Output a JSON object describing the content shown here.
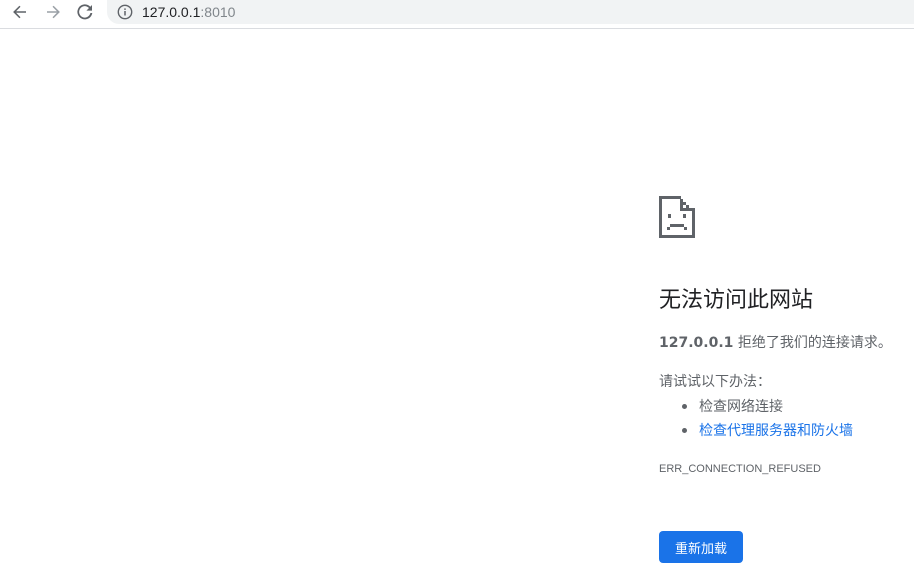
{
  "toolbar": {
    "back_icon": "arrow-left-icon",
    "forward_icon": "arrow-right-icon",
    "reload_icon": "reload-icon",
    "info_icon": "info-icon",
    "url_host": "127.0.0.1",
    "url_port": ":8010"
  },
  "error_page": {
    "icon": "sad-page-icon",
    "headline": "无法访问此网站",
    "host": "127.0.0.1",
    "message_rest": " 拒绝了我们的连接请求。",
    "try_label": "请试试以下办法：",
    "suggestions": [
      {
        "label": "检查网络连接",
        "is_link": false
      },
      {
        "label": "检查代理服务器和防火墙",
        "is_link": true
      }
    ],
    "error_code": "ERR_CONNECTION_REFUSED",
    "reload_label": "重新加载"
  },
  "colors": {
    "accent": "#1a73e8",
    "text_primary": "#202124",
    "text_secondary": "#5f6368",
    "omnibox_bg": "#f1f3f4"
  }
}
